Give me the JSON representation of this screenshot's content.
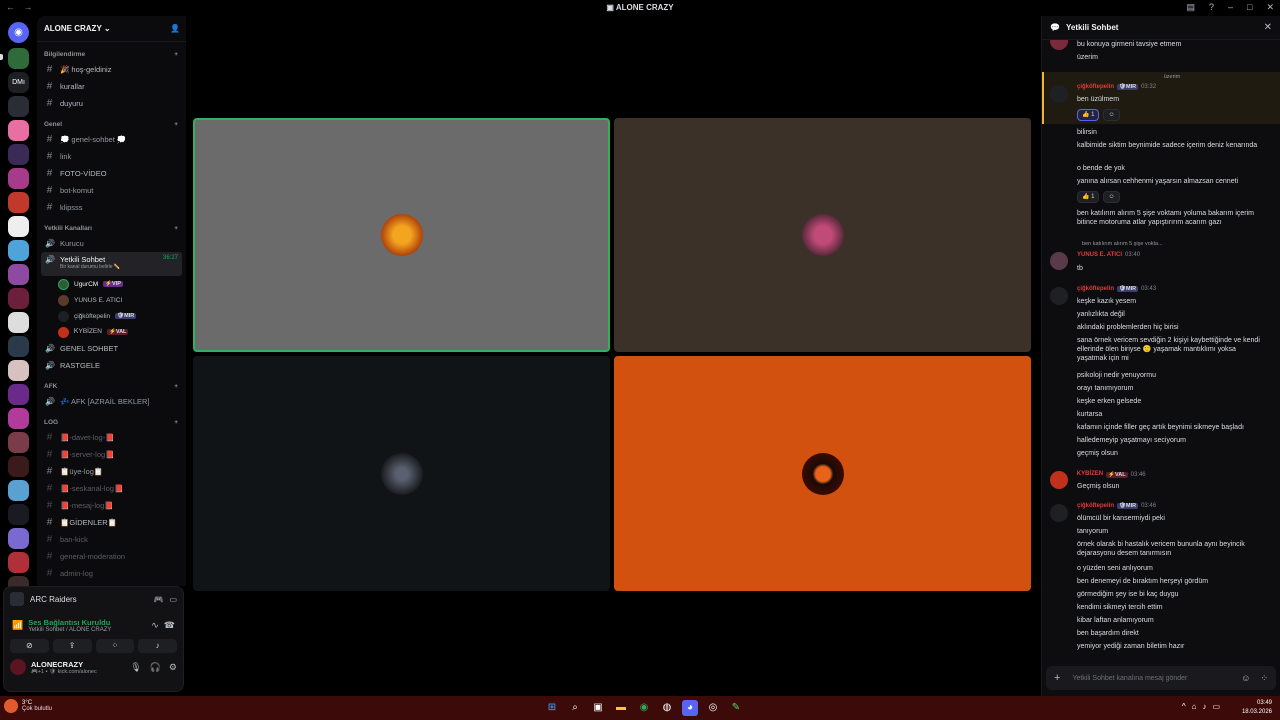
{
  "titlebar": {
    "title": "ALONE CRAZY"
  },
  "server": {
    "name": "ALONE CRAZY"
  },
  "categories": [
    {
      "label": "Bilgilendirme",
      "channels": [
        "🎉 hoş-geldiniz",
        "kurallar",
        "duyuru"
      ]
    },
    {
      "label": "Genel",
      "channels": [
        "💭 genel-sohbet 💭",
        "link",
        "FOTO-VİDEO",
        "bot-komut",
        "klipsss"
      ]
    },
    {
      "label": "Yetkili Kanalları",
      "voice": [
        "Kurucu"
      ]
    },
    {
      "label": "AFK",
      "voice": [
        "💤 AFK [AZRAİL BEKLER]"
      ]
    },
    {
      "label": "LOG",
      "channels": [
        "📕-davet-log-📕",
        "📕-server-log📕",
        "📋üye-log📋",
        "📕-seskanal-log📕",
        "📕-mesaj-log📕",
        "📋GİDENLER📋",
        "ban-kick",
        "general-moderation",
        "admin-log"
      ]
    }
  ],
  "active_voice": {
    "name": "Yetkili Sohbet",
    "timer": "36:27",
    "status": "Bir kanal durumu belirle ✏️"
  },
  "voice_users": [
    {
      "name": "UgurCM",
      "badge": "⚡VIP",
      "badge_color": "#6a2c8a"
    },
    {
      "name": "YUNUS E. ATICI",
      "badge": "",
      "badge_color": ""
    },
    {
      "name": "çiğköftepelin",
      "badge": "🛡MIR",
      "badge_color": "#3c3c6e"
    },
    {
      "name": "ᏦYBİZEN",
      "badge": "⚡VAL",
      "badge_color": "#5a1e2c"
    }
  ],
  "more_voice": [
    "GENEL SOHBET",
    "RASTGELE"
  ],
  "panel": {
    "activity": "ARC Raiders",
    "voice_status": "Ses Bağlantısı Kuruldu",
    "voice_channel": "Yetkili Sohbet / ALONE CRAZY",
    "username": "ALONECRAZY",
    "user_status": "🎮+1 • 🛡 kick.com/alonec"
  },
  "chat": {
    "title": "Yetkili Sohbet",
    "placeholder": "Yetkili Sohbet kanalına mesaj gönder",
    "lines": {
      "l1": "bu konuya girmeni tavsiye etmem",
      "l2": "üzerim",
      "reply1": "üzerim",
      "a1": "çiğköftepelin",
      "a1b": "🛡MIR",
      "a1t": "03:32",
      "l3": "ben üzülmem",
      "l4": "bilirsin",
      "l5": "kalbimide siktim beynimide sadece içerim deniz kenarında",
      "l6": "o bende de yok",
      "l7": "yanına alırsan cehhenmi yaşarsın almazsan cenneti",
      "l8": "ben katılırım alırım 5 şişe voktamı yoluma bakarım içerim bitince motoruma atlar yapıştırırım acarım gazı",
      "reply2": "ben katılırım alırım 5 şişe vokta...",
      "a2": "YUNUS E. ATICI",
      "a2t": "03:40",
      "l9": "tb",
      "a3": "çiğköftepelin",
      "a3b": "🛡MIR",
      "a3t": "03:43",
      "l10": "keşke kazık yesem",
      "l11": "yanlızlıkta değil",
      "l12": "aklındaki problemlerden hiç birisi",
      "l13": "sana örnek vericem sevdiğin 2 kişiyi kaybettiğinde ve kendi ellerinde ölen biriyse 🙂 yaşamak mantıklımı yoksa yaşatmak için mi",
      "l14": "psikoloji nedir yenuyormu",
      "l15": "orayı tanımıyorum",
      "l16": "keşke erken gelsede",
      "l17": "kurtarsa",
      "l18": "kafamın içinde filler geç artık beynimi sikmeye başladı",
      "l19": "halledemeyip yaşatmayı seciyorum",
      "l20": "geçmiş olsun",
      "a4": "ᏦYBİZEN",
      "a4b": "⚡VAL",
      "a4t": "03:46",
      "l21": "Geçmiş olsun",
      "a5": "çiğköftepelin",
      "a5b": "🛡MIR",
      "a5t": "03:46",
      "l22": "ölümcül  bir kansermiydi peki",
      "l23": "tanıyorum",
      "l24": "örnek olarak bi hastalık vericem bununla aynı beyincik dejarasyonu  desem tanırmısın",
      "l25": "o yüzden seni anlıyorum",
      "l26": "ben denemeyi de bıraktım herşeyi gördüm",
      "l27": "görmediğim şey ise bi kaç duygu",
      "l28": "kendimi sikmeyi tercih ettim",
      "l29": "kibar laftan anlamıyorum",
      "l30": "ben başardım direkt",
      "l31": "yemiyor yediği zaman biletim hazır",
      "react_count": "1"
    }
  },
  "taskbar": {
    "temp": "3°C",
    "weather": "Çok bulutlu",
    "time": "03:49",
    "date": "18.03.2026"
  },
  "colors": {
    "accent": "#5865f2",
    "green": "#23a55a",
    "taskbar": "#3d0a0a",
    "tile_gray": "#6b6b6b",
    "tile_brown": "#3b3128",
    "tile_dark": "#111416",
    "tile_orange": "#d2510e"
  }
}
